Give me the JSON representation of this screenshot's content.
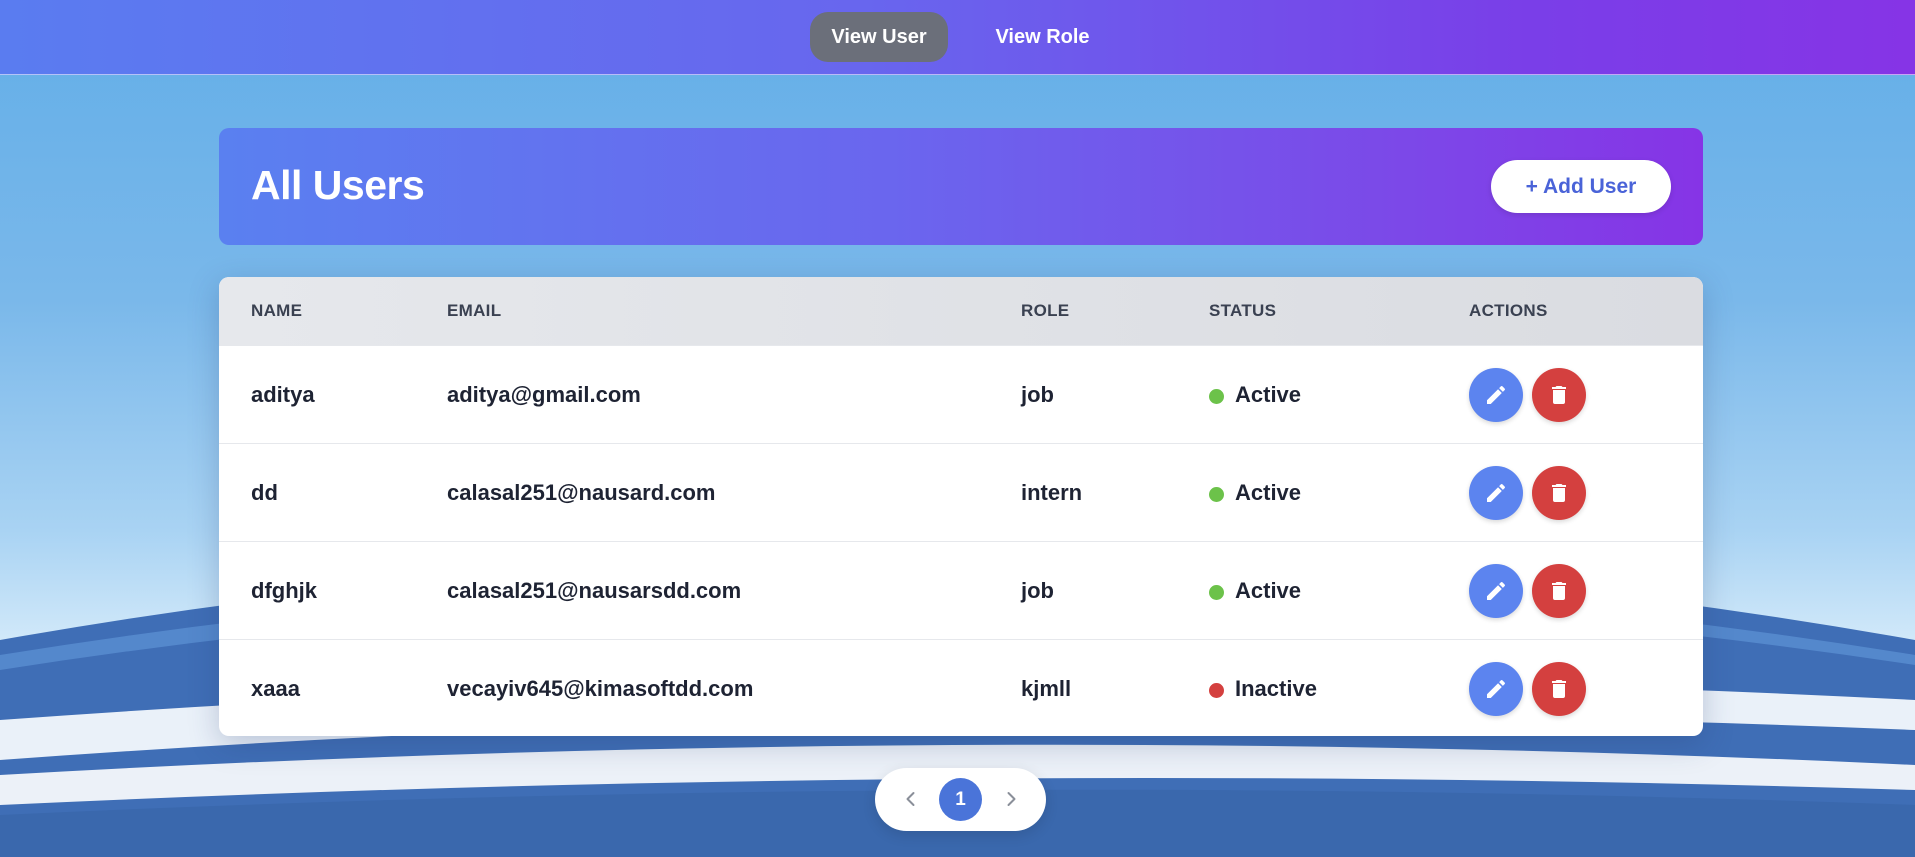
{
  "nav": {
    "tabs": [
      {
        "label": "View User",
        "active": true
      },
      {
        "label": "View Role",
        "active": false
      }
    ]
  },
  "header": {
    "title": "All Users",
    "add_button_label": "+ Add User"
  },
  "table": {
    "columns": [
      "NAME",
      "EMAIL",
      "ROLE",
      "STATUS",
      "ACTIONS"
    ],
    "rows": [
      {
        "name": "aditya",
        "email": "aditya@gmail.com",
        "role": "job",
        "status": "Active"
      },
      {
        "name": "dd",
        "email": "calasal251@nausard.com",
        "role": "intern",
        "status": "Active"
      },
      {
        "name": "dfghjk",
        "email": "calasal251@nausarsdd.com",
        "role": "job",
        "status": "Active"
      },
      {
        "name": "xaaa",
        "email": "vecayiv645@kimasoftdd.com",
        "role": "kjmll",
        "status": "Inactive"
      }
    ],
    "row_actions": [
      "edit-icon",
      "trash-icon"
    ]
  },
  "pagination": {
    "current_page": "1",
    "prev_icon": "chevron-left-icon",
    "next_icon": "chevron-right-icon"
  },
  "colors": {
    "accent": "#5a80f0",
    "accent_end": "#8634e6",
    "status_active": "#6cc24a",
    "status_inactive": "#d4403f",
    "edit_button": "#5c84ef",
    "delete_button": "#d4403f",
    "page_active": "#4a74d9"
  }
}
